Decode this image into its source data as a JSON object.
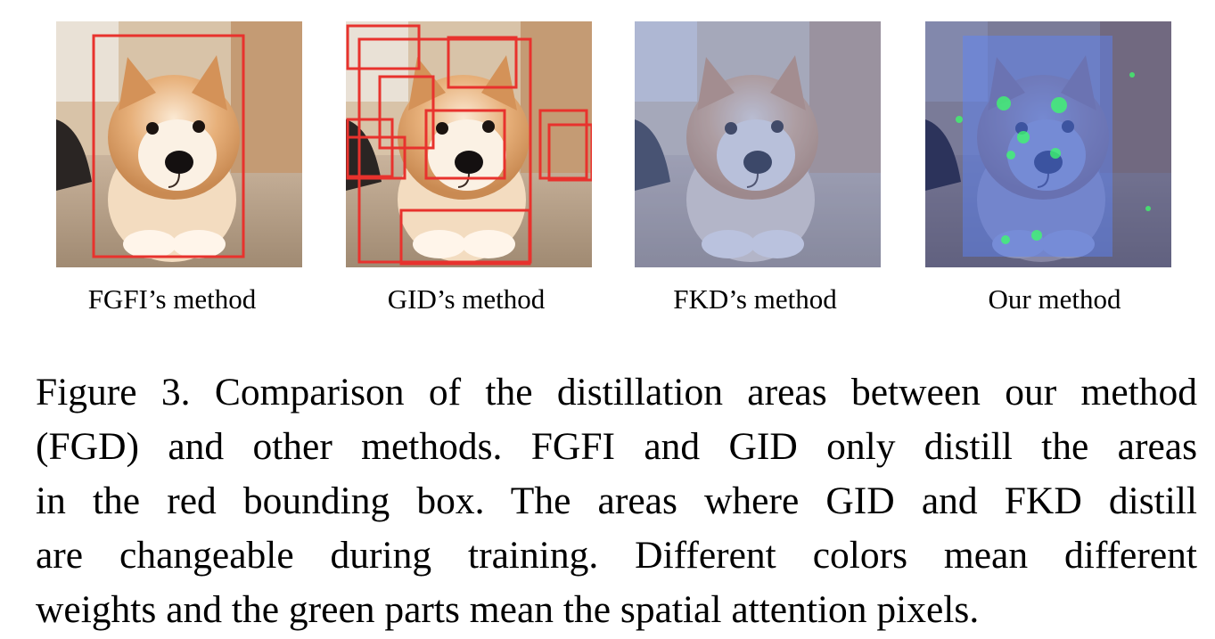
{
  "figure": {
    "panels": [
      {
        "label": "FGFI’s method",
        "overlay": "single-red-box"
      },
      {
        "label": "GID’s method",
        "overlay": "multiple-red-boxes"
      },
      {
        "label": "FKD’s method",
        "overlay": "blue-tint"
      },
      {
        "label": "Our method",
        "overlay": "blue-tint-with-green-attention"
      }
    ],
    "colors": {
      "box_red": "#e8322d",
      "tint_blue": "#4a6fd8",
      "attention_green": "#3cff6a"
    },
    "caption_lines": [
      "Figure 3. Comparison of the distillation areas between our method",
      "(FGD) and other methods.  FGFI and GID only distill the areas",
      "in the red bounding box.  The areas where GID and FKD distill",
      "are changeable during training.  Different colors mean different",
      "weights and the green parts mean the spatial attention pixels."
    ]
  }
}
